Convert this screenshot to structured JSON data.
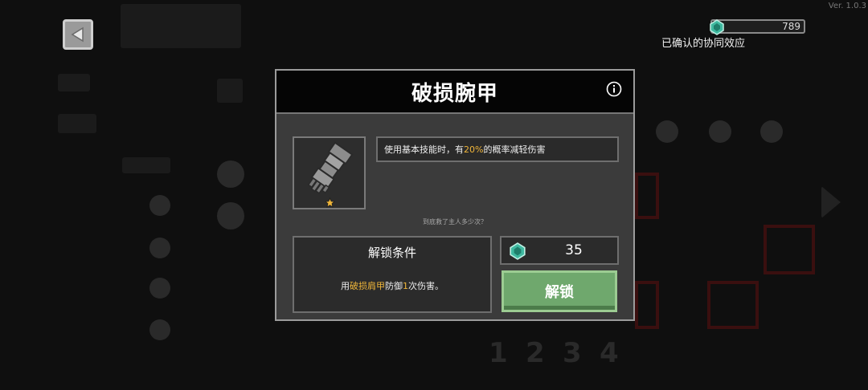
{
  "app": {
    "version": "Ver. 1.0.3"
  },
  "hud": {
    "currency_amount": "789",
    "synergy_label": "已确认的协同效应",
    "background_page_numbers": [
      "1",
      "2",
      "3",
      "4"
    ]
  },
  "modal": {
    "title": "破损腕甲",
    "description": {
      "prefix": "使用基本技能时，有",
      "highlight": "20%",
      "suffix": "的概率减轻伤害"
    },
    "hint": "到底救了主人多少次？",
    "unlock_condition": {
      "title": "解锁条件",
      "prefix": "用",
      "highlight_item": "破损肩甲",
      "middle": "防御",
      "count": "1",
      "suffix": "次伤害。"
    },
    "cost": "35",
    "unlock_button": "解锁"
  },
  "colors": {
    "accent_highlight": "#f0b63a",
    "unlock_button": "#6fa86d",
    "gem": "#3fb9a0"
  },
  "icons": {
    "back": "back-arrow-icon",
    "info": "info-icon",
    "gem": "gem-icon",
    "item": "gauntlet-icon",
    "star": "star-icon"
  }
}
